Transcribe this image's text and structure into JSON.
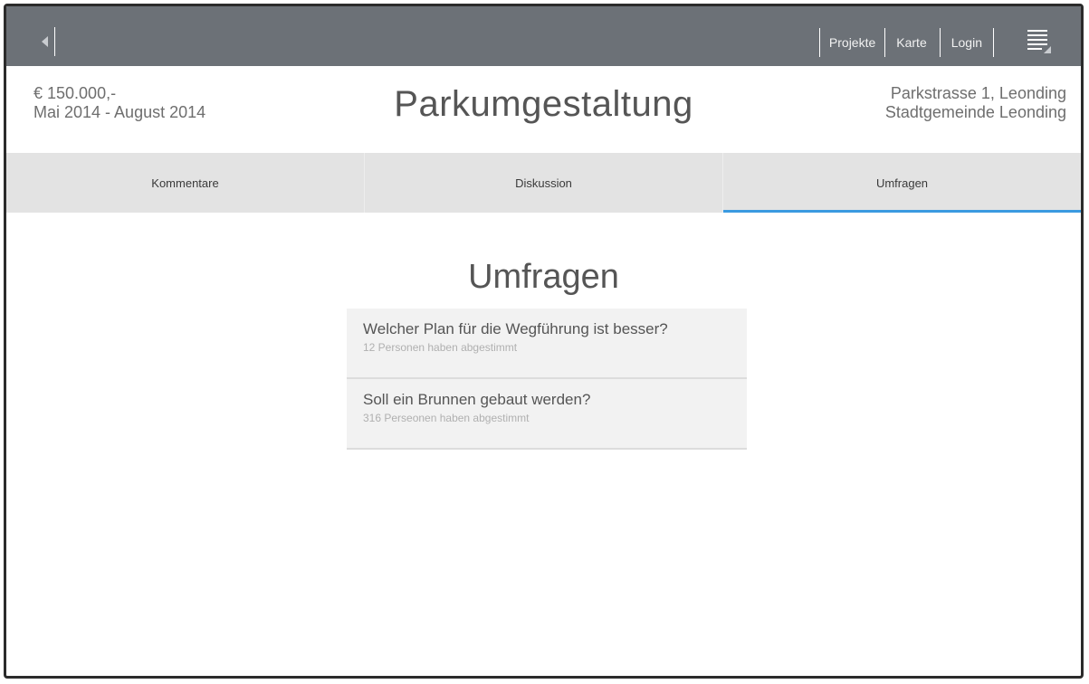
{
  "topbar": {
    "nav": [
      "Projekte",
      "Karte",
      "Login"
    ],
    "icons": {
      "back": "back-arrow-icon",
      "menu": "hamburger-menu-icon"
    }
  },
  "project": {
    "budget": "€ 150.000,-",
    "period": "Mai 2014 - August 2014",
    "title": "Parkumgestaltung",
    "address": "Parkstrasse 1, Leonding",
    "municipality": "Stadtgemeinde Leonding"
  },
  "tabs": [
    {
      "label": "Kommentare",
      "active": false
    },
    {
      "label": "Diskussion",
      "active": false
    },
    {
      "label": "Umfragen",
      "active": true
    }
  ],
  "polls_section": {
    "title": "Umfragen",
    "items": [
      {
        "question": "Welcher Plan für die Wegführung ist besser?",
        "votes": "12 Personen haben abgestimmt"
      },
      {
        "question": "Soll ein Brunnen gebaut werden?",
        "votes": "316 Perseonen haben abgestimmt"
      }
    ]
  },
  "colors": {
    "topbar": "#6c7177",
    "tabs_bg": "#e3e3e3",
    "active_tab_underline": "#3a9ae0",
    "poll_bg": "#f2f2f2"
  }
}
